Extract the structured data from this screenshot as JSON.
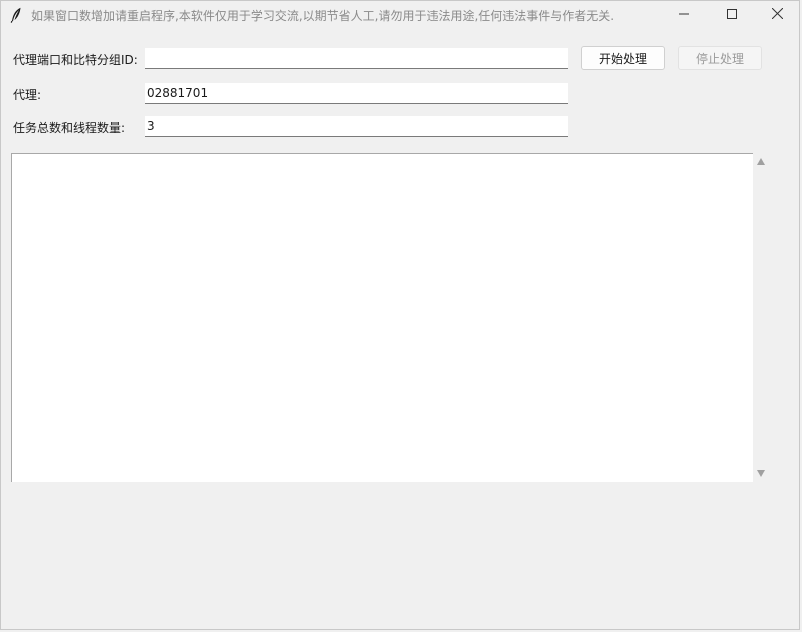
{
  "window": {
    "title": "如果窗口数增加请重启程序,本软件仅用于学习交流,以期节省人工,请勿用于违法用途,任何违法事件与作者无关."
  },
  "form": {
    "port_label": "代理端口和比特分组ID:",
    "port_value": "",
    "proxy_label": "代理:",
    "proxy_value": "02881701",
    "threads_label": "任务总数和线程数量:",
    "threads_value": "3"
  },
  "buttons": {
    "start_label": "开始处理",
    "stop_label": "停止处理"
  },
  "log": {
    "content": ""
  },
  "icons": {
    "app": "feather-icon",
    "minimize": "minimize-icon",
    "maximize": "maximize-icon",
    "close": "close-icon",
    "scroll_up": "scroll-up-arrow-icon",
    "scroll_down": "scroll-down-arrow-icon"
  },
  "colors": {
    "window_bg": "#f0f0f0",
    "title_text": "#8a8a8a",
    "disabled_text": "#9a9a9a"
  }
}
